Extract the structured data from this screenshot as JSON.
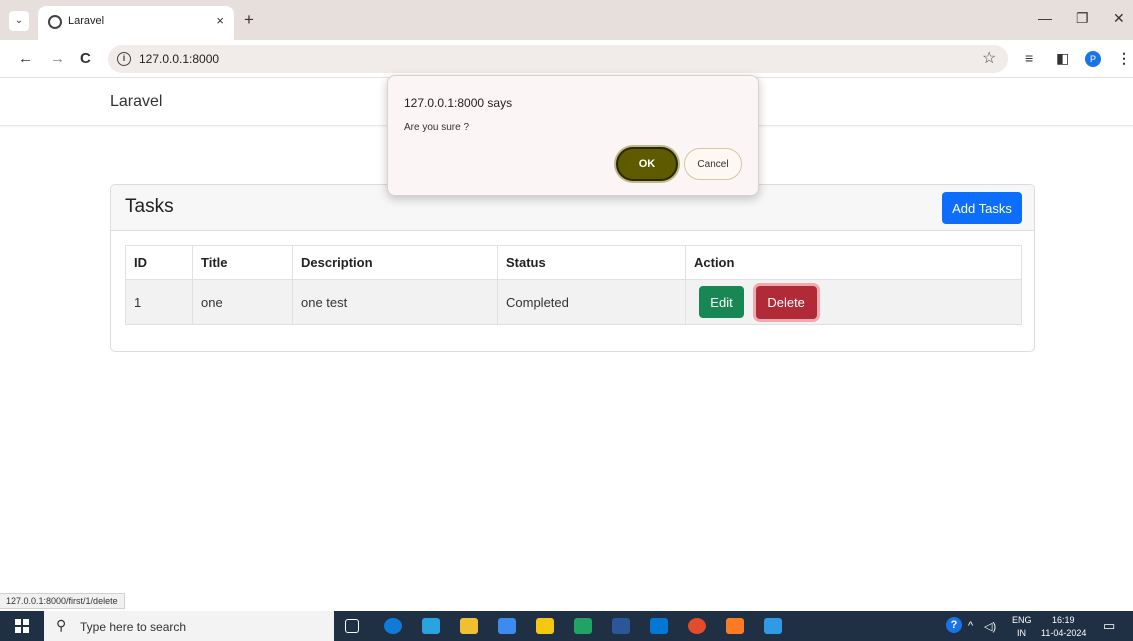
{
  "browser": {
    "tab_title": "Laravel",
    "tab_close": "×",
    "new_tab": "+",
    "tab_menu": "⌄",
    "win_minimize": "—",
    "win_restore": "❐",
    "win_close": "✕",
    "back": "←",
    "forward": "→",
    "reload": "C",
    "url": "127.0.0.1:8000",
    "profile_initial": "P",
    "status_url": "127.0.0.1:8000/first/1/delete"
  },
  "page": {
    "brand": "Laravel",
    "card_title": "Tasks",
    "add_button": "Add Tasks",
    "table": {
      "headers": [
        "ID",
        "Title",
        "Description",
        "Status",
        "Action"
      ],
      "rows": [
        {
          "id": "1",
          "title": "one",
          "description": "one test",
          "status": "Completed",
          "edit_label": "Edit",
          "delete_label": "Delete"
        }
      ]
    }
  },
  "dialog": {
    "title": "127.0.0.1:8000 says",
    "message": "Are you sure ?",
    "ok_label": "OK",
    "cancel_label": "Cancel"
  },
  "taskbar": {
    "search_placeholder": "Type here to search",
    "language": "ENG",
    "region": "IN",
    "time": "16:19",
    "date": "11-04-2024",
    "app_colors": [
      "#0f7ad8",
      "#2aa3e0",
      "#f0c030",
      "#3d8bf0",
      "#f2c811",
      "#21a366",
      "#2b579a",
      "#0078d4",
      "#e24c2c",
      "#fb7a24",
      "#2f9be6"
    ]
  }
}
